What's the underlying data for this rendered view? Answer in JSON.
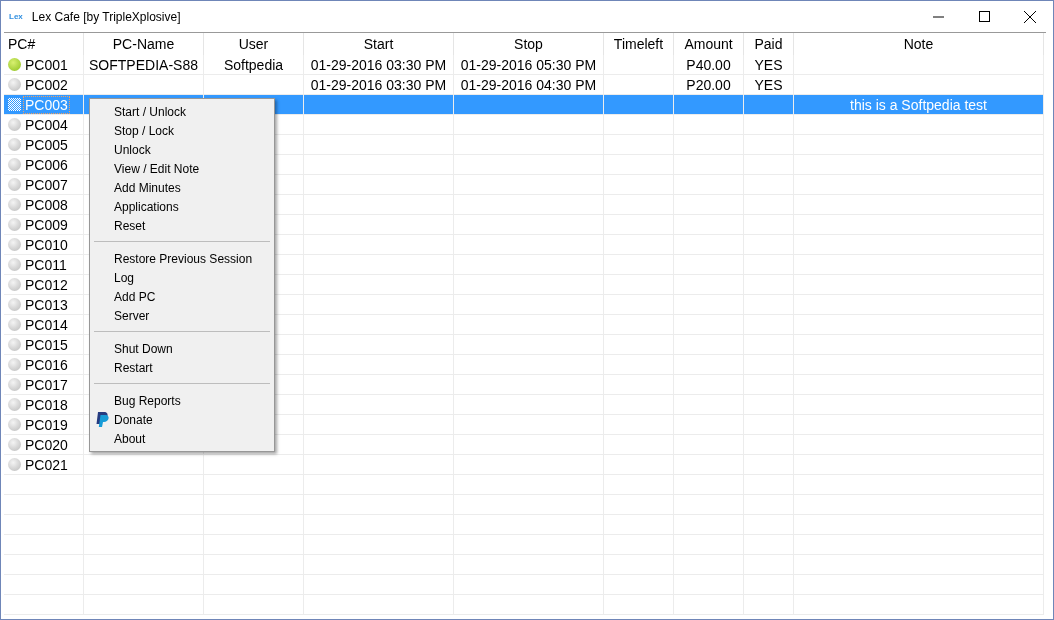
{
  "window": {
    "app_icon_text": "Lex",
    "title": "Lex Cafe [by TripleXplosive]"
  },
  "table": {
    "columns": [
      "PC#",
      "PC-Name",
      "User",
      "Start",
      "Stop",
      "Timeleft",
      "Amount",
      "Paid",
      "Note"
    ],
    "rows": [
      {
        "pc": "PC001",
        "online": true,
        "selected": false,
        "pc_name": "SOFTPEDIA-S88",
        "user": "Softpedia",
        "start": "01-29-2016 03:30 PM",
        "stop": "01-29-2016 05:30 PM",
        "amount": "P40.00",
        "paid": "YES"
      },
      {
        "pc": "PC002",
        "online": false,
        "selected": false,
        "start": "01-29-2016 03:30 PM",
        "stop": "01-29-2016 04:30 PM",
        "amount": "P20.00",
        "paid": "YES"
      },
      {
        "pc": "PC003",
        "online": false,
        "selected": true,
        "note": "this is a Softpedia test"
      },
      {
        "pc": "PC004",
        "online": false,
        "selected": false
      },
      {
        "pc": "PC005",
        "online": false,
        "selected": false
      },
      {
        "pc": "PC006",
        "online": false,
        "selected": false
      },
      {
        "pc": "PC007",
        "online": false,
        "selected": false
      },
      {
        "pc": "PC008",
        "online": false,
        "selected": false
      },
      {
        "pc": "PC009",
        "online": false,
        "selected": false
      },
      {
        "pc": "PC010",
        "online": false,
        "selected": false
      },
      {
        "pc": "PC011",
        "online": false,
        "selected": false
      },
      {
        "pc": "PC012",
        "online": false,
        "selected": false
      },
      {
        "pc": "PC013",
        "online": false,
        "selected": false
      },
      {
        "pc": "PC014",
        "online": false,
        "selected": false
      },
      {
        "pc": "PC015",
        "online": false,
        "selected": false
      },
      {
        "pc": "PC016",
        "online": false,
        "selected": false
      },
      {
        "pc": "PC017",
        "online": false,
        "selected": false
      },
      {
        "pc": "PC018",
        "online": false,
        "selected": false
      },
      {
        "pc": "PC019",
        "online": false,
        "selected": false
      },
      {
        "pc": "PC020",
        "online": false,
        "selected": false
      },
      {
        "pc": "PC021",
        "online": false,
        "selected": false
      }
    ]
  },
  "context_menu": {
    "sections": [
      {
        "items": [
          {
            "label": "Start / Unlock",
            "kind": "text"
          },
          {
            "label": "Stop / Lock",
            "kind": "text"
          },
          {
            "label": "Unlock",
            "kind": "text"
          },
          {
            "label": "View / Edit Note",
            "kind": "text"
          },
          {
            "label": "Add Minutes",
            "kind": "text"
          },
          {
            "label": "Applications",
            "kind": "text"
          },
          {
            "label": "Reset",
            "kind": "text"
          }
        ]
      },
      {
        "items": [
          {
            "label": "Restore Previous Session",
            "kind": "text"
          },
          {
            "label": "Log",
            "kind": "text"
          },
          {
            "label": "Add PC",
            "kind": "text"
          },
          {
            "label": "Server",
            "kind": "text"
          }
        ]
      },
      {
        "items": [
          {
            "label": "Shut Down",
            "kind": "text"
          },
          {
            "label": "Restart",
            "kind": "text"
          }
        ]
      },
      {
        "items": [
          {
            "label": "Bug Reports",
            "kind": "text"
          },
          {
            "label": "Donate",
            "kind": "icon"
          },
          {
            "label": "About",
            "kind": "text"
          }
        ]
      }
    ]
  }
}
